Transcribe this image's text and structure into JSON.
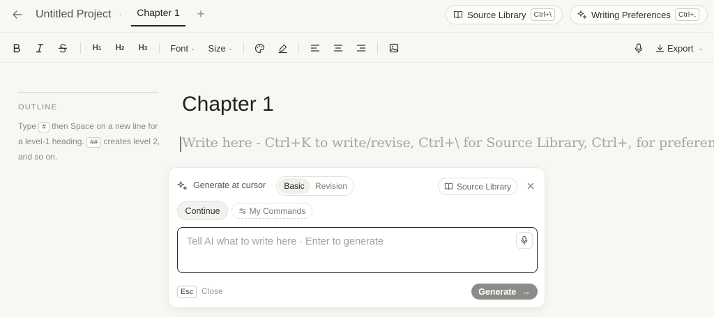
{
  "header": {
    "project_title": "Untitled Project",
    "separator": "·",
    "tabs": [
      {
        "label": "Chapter 1",
        "active": true
      }
    ],
    "add_tab": "+",
    "source_library": {
      "label": "Source Library",
      "shortcut": "Ctrl+\\"
    },
    "writing_preferences": {
      "label": "Writing Preferences",
      "shortcut": "Ctrl+,"
    }
  },
  "toolbar": {
    "h1": "H",
    "h1_sub": "1",
    "h2": "H",
    "h2_sub": "2",
    "h3": "H",
    "h3_sub": "3",
    "font_label": "Font",
    "size_label": "Size",
    "export_label": "Export",
    "icons": [
      "bold-icon",
      "italic-icon",
      "strikethrough-icon",
      "palette-icon",
      "highlighter-icon",
      "align-left-icon",
      "align-center-icon",
      "align-right-icon",
      "image-icon",
      "microphone-icon",
      "download-icon"
    ]
  },
  "outline": {
    "heading": "OUTLINE",
    "help_1": "Type",
    "kbd_1": "#",
    "help_2": "then Space on a new line for a level-1 heading.",
    "kbd_2": "##",
    "help_3": "creates level 2, and so on."
  },
  "editor": {
    "title": "Chapter 1",
    "placeholder": "Write here - Ctrl+K to write/revise, Ctrl+\\ for Source Library, Ctrl+, for preferences"
  },
  "ai_panel": {
    "header_label": "Generate at cursor",
    "modes": [
      {
        "label": "Basic",
        "active": true
      },
      {
        "label": "Revision",
        "active": false
      }
    ],
    "source_library_label": "Source Library",
    "continue_label": "Continue",
    "my_commands_label": "My Commands",
    "input_placeholder": "Tell AI what to write here · Enter to generate",
    "esc_key": "Esc",
    "close_label": "Close",
    "generate_label": "Generate",
    "generate_arrow": "→"
  },
  "colors": {
    "background": "#f8f7f3",
    "panel": "#ffffff",
    "generate_button": "#8c8b88",
    "placeholder_text": "#a7a5a0"
  }
}
